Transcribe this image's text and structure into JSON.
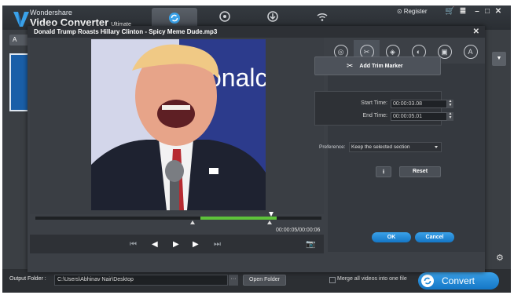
{
  "app": {
    "brand_small": "Wondershare",
    "brand_title": "Video Converter",
    "brand_edition": "Ultimate",
    "register_label": "Register",
    "colors": {
      "accent": "#1e8ad8",
      "trim_fill": "#5ec33a",
      "background": "#3b3f44"
    }
  },
  "top_tabs": [
    {
      "name": "convert",
      "icon": "convert-icon",
      "active": true
    },
    {
      "name": "burn",
      "icon": "disc-icon",
      "active": false
    },
    {
      "name": "download",
      "icon": "download-icon",
      "active": false
    },
    {
      "name": "transfer",
      "icon": "wifi-icon",
      "active": false
    }
  ],
  "dialog": {
    "title": "Donald Trump Roasts Hillary Clinton - Spicy Meme Dude.mp3",
    "video_overlay_text": "onalc",
    "time_readout": "00:00:05/00:00:06",
    "trim": {
      "start_fraction": 0.0,
      "selected_start_fraction": 0.55,
      "selected_end_fraction": 0.82
    },
    "tabs": [
      {
        "icon": "effects-icon",
        "active": false
      },
      {
        "icon": "scissors-icon",
        "active": true
      },
      {
        "icon": "crop-icon",
        "active": false
      },
      {
        "icon": "adjust-icon",
        "active": false
      },
      {
        "icon": "watermark-icon",
        "active": false
      },
      {
        "icon": "subtitle-icon",
        "active": false
      }
    ],
    "add_trim_marker": "Add Trim Marker",
    "start_time_label": "Start Time:",
    "start_time_value": "00:00:03.08",
    "end_time_label": "End Time:",
    "end_time_value": "00:00:05.01",
    "preference_label": "Preference:",
    "preference_value": "Keep the selected section",
    "reset_label": "Reset",
    "ok_label": "OK",
    "cancel_label": "Cancel"
  },
  "bottom": {
    "output_folder_label": "Output Folder :",
    "output_path": "C:\\Users\\Abhinav Nair\\Desktop",
    "more_label": "···",
    "open_folder_label": "Open Folder",
    "merge_label": "Merge all videos into one file",
    "convert_label": "Convert"
  },
  "left_panel": {
    "add_label": "A"
  }
}
